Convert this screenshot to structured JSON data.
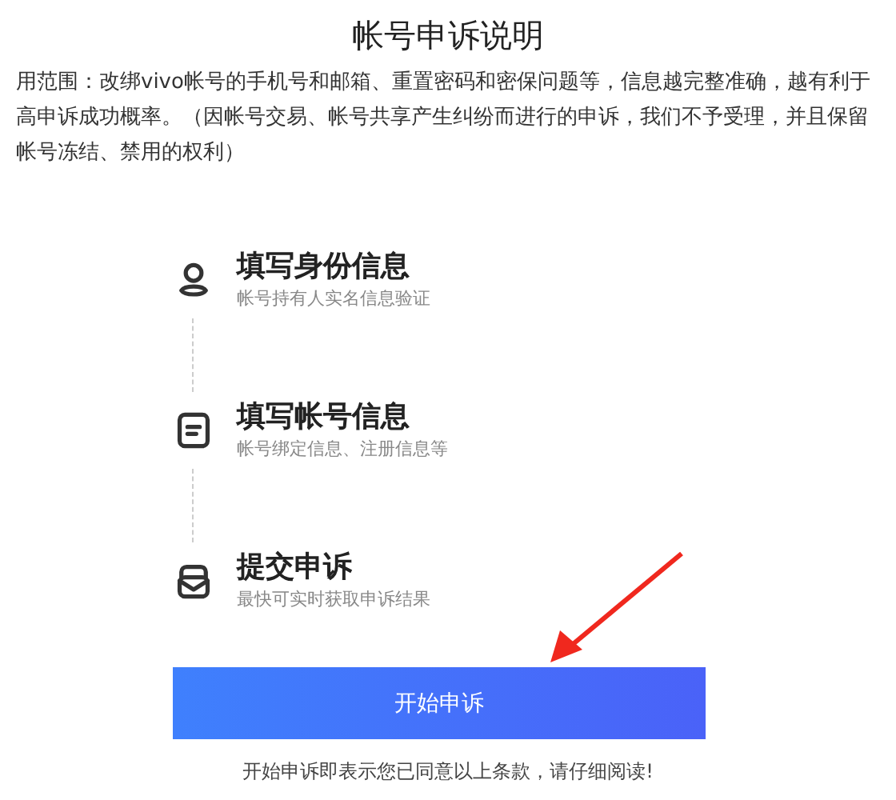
{
  "title": "帐号申诉说明",
  "description_lines": [
    "用范围：改绑vivo帐号的手机号和邮箱、重置密码和密保问题等，信息越完整准确，越有利于",
    "高申诉成功概率。（因帐号交易、帐号共享产生纠纷而进行的申诉，我们不予受理，并且保留",
    "帐号冻结、禁用的权利）"
  ],
  "steps": [
    {
      "kind": "person",
      "title": "填写身份信息",
      "subtitle": "帐号持有人实名信息验证"
    },
    {
      "kind": "form",
      "title": "填写帐号信息",
      "subtitle": "帐号绑定信息、注册信息等"
    },
    {
      "kind": "submit",
      "title": "提交申诉",
      "subtitle": "最快可实时获取申诉结果"
    }
  ],
  "button": "开始申诉",
  "footer": "开始申诉即表示您已同意以上条款，请仔细阅读!"
}
